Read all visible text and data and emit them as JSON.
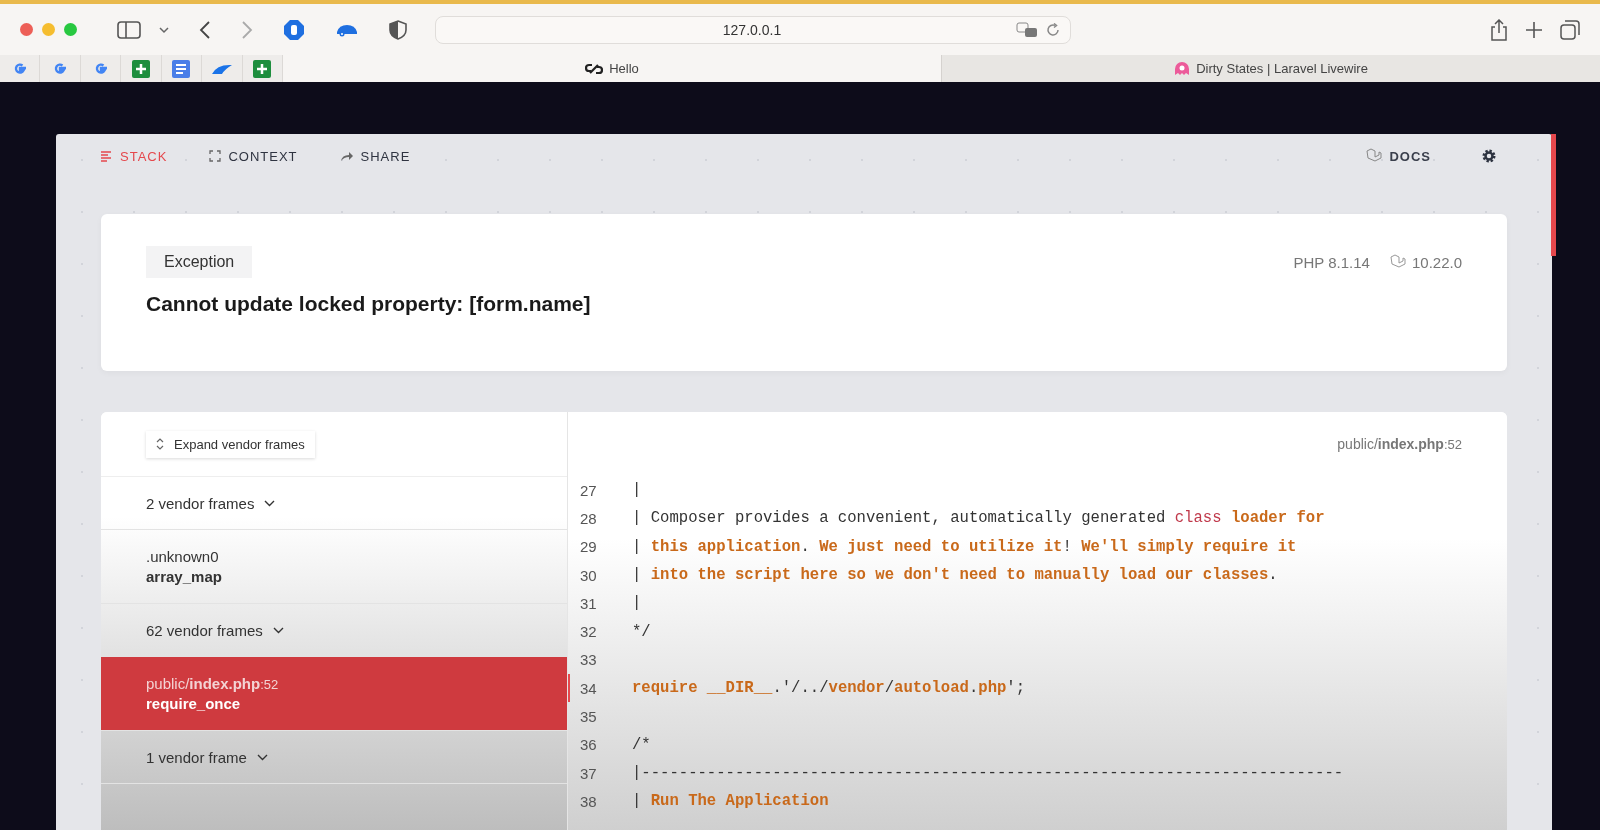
{
  "browser": {
    "address": "127.0.0.1",
    "tabs": [
      {
        "title": "Hello",
        "selected": true
      },
      {
        "title": "Dirty States | Laravel Livewire",
        "selected": false
      }
    ]
  },
  "nav": {
    "tabs": [
      {
        "label": "STACK",
        "selected": true
      },
      {
        "label": "CONTEXT",
        "selected": false
      },
      {
        "label": "SHARE",
        "selected": false
      }
    ],
    "docs": "DOCS"
  },
  "exception": {
    "type": "Exception",
    "message": "Cannot update locked property: [form.name]",
    "php": "PHP 8.1.14",
    "laravel": "10.22.0"
  },
  "frames": {
    "expand_button": "Expand vendor frames",
    "items": [
      {
        "kind": "group",
        "label": "2 vendor frames"
      },
      {
        "kind": "frame",
        "file": ".unknown0",
        "method": "array_map",
        "selected": false
      },
      {
        "kind": "group",
        "label": "62 vendor frames"
      },
      {
        "kind": "frame",
        "file": "public/**index.php**",
        "line": ":52",
        "method": "require_once",
        "selected": true
      },
      {
        "kind": "group",
        "label": "1 vendor frame"
      }
    ]
  },
  "code": {
    "file": "public/**index.php**",
    "line": ":52",
    "lines": [
      {
        "number": "27",
        "highlighted": false,
        "segments": [
          {
            "text": "|",
            "kind": "plain"
          }
        ]
      },
      {
        "number": "28",
        "highlighted": false,
        "segments": [
          {
            "text": "| Composer provides a convenient, automatically generated ",
            "kind": "plain"
          },
          {
            "text": "class",
            "kind": "accent"
          },
          {
            "text": " loader for",
            "kind": "keyword"
          }
        ]
      },
      {
        "number": "29",
        "highlighted": false,
        "segments": [
          {
            "text": "| ",
            "kind": "plain"
          },
          {
            "text": "this application",
            "kind": "keyword"
          },
          {
            "text": ". ",
            "kind": "plain"
          },
          {
            "text": "We just need to utilize it",
            "kind": "keyword"
          },
          {
            "text": "! ",
            "kind": "plain"
          },
          {
            "text": "We'll simply require it",
            "kind": "keyword"
          }
        ]
      },
      {
        "number": "30",
        "highlighted": false,
        "segments": [
          {
            "text": "| ",
            "kind": "plain"
          },
          {
            "text": "into the script here so we don't need to manually load our classes",
            "kind": "keyword"
          },
          {
            "text": ".",
            "kind": "plain"
          }
        ]
      },
      {
        "number": "31",
        "highlighted": false,
        "segments": [
          {
            "text": "|",
            "kind": "plain"
          }
        ]
      },
      {
        "number": "32",
        "highlighted": false,
        "segments": [
          {
            "text": "*/",
            "kind": "plain"
          }
        ]
      },
      {
        "number": "33",
        "highlighted": false
      },
      {
        "number": "34",
        "highlighted": true,
        "segments": [
          {
            "text": "require __DIR__",
            "kind": "keyword"
          },
          {
            "text": ".'/../",
            "kind": "plain"
          },
          {
            "text": "vendor",
            "kind": "keyword"
          },
          {
            "text": "/",
            "kind": "plain"
          },
          {
            "text": "autoload",
            "kind": "keyword"
          },
          {
            "text": ".",
            "kind": "plain"
          },
          {
            "text": "php",
            "kind": "keyword"
          },
          {
            "text": "';",
            "kind": "plain"
          }
        ]
      },
      {
        "number": "35",
        "highlighted": false
      },
      {
        "number": "36",
        "highlighted": false,
        "segments": [
          {
            "text": "/*",
            "kind": "plain"
          }
        ]
      },
      {
        "number": "37",
        "highlighted": false,
        "segments": [
          {
            "text": "|---------------------------------------------------------------------------",
            "kind": "plain"
          }
        ]
      },
      {
        "number": "38",
        "highlighted": false,
        "segments": [
          {
            "text": "| ",
            "kind": "plain"
          },
          {
            "text": "Run The Application",
            "kind": "keyword"
          }
        ]
      }
    ]
  }
}
